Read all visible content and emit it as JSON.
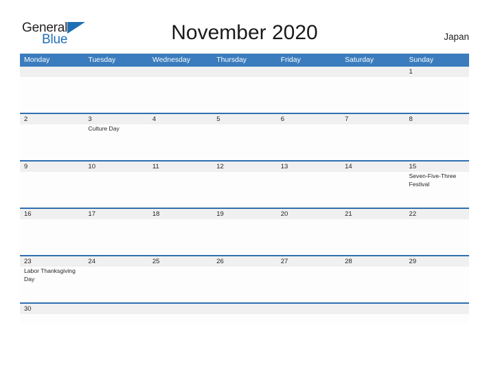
{
  "branding": {
    "logo_primary": "General",
    "logo_secondary": "Blue",
    "logo_accent_color": "#1f6fb5",
    "logo_primary_color": "#231f20"
  },
  "header": {
    "title": "November 2020",
    "region": "Japan"
  },
  "theme": {
    "header_band_color": "#3a7cbd",
    "row_divider_color": "#2f6fb0",
    "date_band_color": "#f0f0f0",
    "cell_background_color": "#fdfdfd",
    "text_color": "#231f20"
  },
  "calendar": {
    "weekdays": [
      "Monday",
      "Tuesday",
      "Wednesday",
      "Thursday",
      "Friday",
      "Saturday",
      "Sunday"
    ],
    "weeks": [
      {
        "height": "tall",
        "days": [
          {
            "date": "",
            "event": ""
          },
          {
            "date": "",
            "event": ""
          },
          {
            "date": "",
            "event": ""
          },
          {
            "date": "",
            "event": ""
          },
          {
            "date": "",
            "event": ""
          },
          {
            "date": "",
            "event": ""
          },
          {
            "date": "1",
            "event": ""
          }
        ]
      },
      {
        "height": "tall",
        "days": [
          {
            "date": "2",
            "event": ""
          },
          {
            "date": "3",
            "event": "Culture Day"
          },
          {
            "date": "4",
            "event": ""
          },
          {
            "date": "5",
            "event": ""
          },
          {
            "date": "6",
            "event": ""
          },
          {
            "date": "7",
            "event": ""
          },
          {
            "date": "8",
            "event": ""
          }
        ]
      },
      {
        "height": "tall",
        "days": [
          {
            "date": "9",
            "event": ""
          },
          {
            "date": "10",
            "event": ""
          },
          {
            "date": "11",
            "event": ""
          },
          {
            "date": "12",
            "event": ""
          },
          {
            "date": "13",
            "event": ""
          },
          {
            "date": "14",
            "event": ""
          },
          {
            "date": "15",
            "event": "Seven-Five-Three Festival"
          }
        ]
      },
      {
        "height": "tall",
        "days": [
          {
            "date": "16",
            "event": ""
          },
          {
            "date": "17",
            "event": ""
          },
          {
            "date": "18",
            "event": ""
          },
          {
            "date": "19",
            "event": ""
          },
          {
            "date": "20",
            "event": ""
          },
          {
            "date": "21",
            "event": ""
          },
          {
            "date": "22",
            "event": ""
          }
        ]
      },
      {
        "height": "tall",
        "days": [
          {
            "date": "23",
            "event": "Labor Thanksgiving Day"
          },
          {
            "date": "24",
            "event": ""
          },
          {
            "date": "25",
            "event": ""
          },
          {
            "date": "26",
            "event": ""
          },
          {
            "date": "27",
            "event": ""
          },
          {
            "date": "28",
            "event": ""
          },
          {
            "date": "29",
            "event": ""
          }
        ]
      },
      {
        "height": "short",
        "days": [
          {
            "date": "30",
            "event": ""
          },
          {
            "date": "",
            "event": ""
          },
          {
            "date": "",
            "event": ""
          },
          {
            "date": "",
            "event": ""
          },
          {
            "date": "",
            "event": ""
          },
          {
            "date": "",
            "event": ""
          },
          {
            "date": "",
            "event": ""
          }
        ]
      }
    ]
  }
}
